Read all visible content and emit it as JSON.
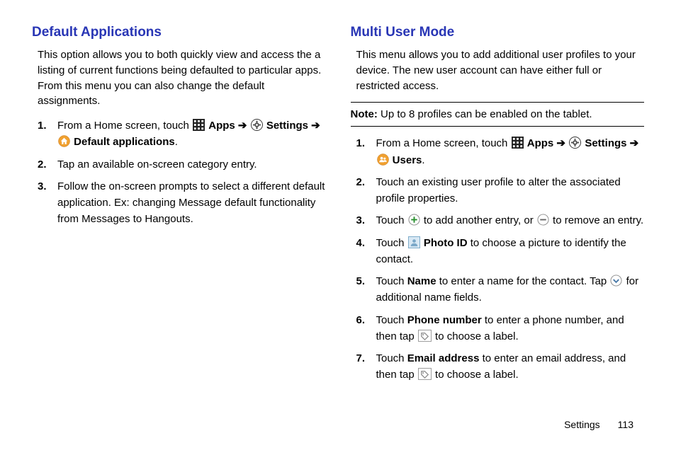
{
  "left": {
    "heading": "Default Applications",
    "intro": "This option allows you to both quickly view and access the a listing of current functions being defaulted to particular apps. From this menu you can also change the default assignments.",
    "steps": {
      "s1_a": "From a Home screen, touch ",
      "s1_apps": "Apps",
      "s1_arrow1": " ➔ ",
      "s1_settings": "Settings",
      "s1_arrow2": " ➔ ",
      "s1_default": "Default applications",
      "s1_end": ".",
      "s2": "Tap an available on-screen category entry.",
      "s3": "Follow the on-screen prompts to select a different default application. Ex: changing Message default functionality from Messages to Hangouts."
    }
  },
  "right": {
    "heading": "Multi User Mode",
    "intro": "This menu allows you to add additional user profiles to your device. The new user account can have either full or restricted access.",
    "note_label": "Note:",
    "note_text": " Up to 8 profiles can be enabled on the tablet.",
    "steps": {
      "s1_a": "From a Home screen, touch ",
      "s1_apps": "Apps",
      "s1_arrow1": " ➔ ",
      "s1_settings": "Settings",
      "s1_arrow2": " ➔ ",
      "s1_users": "Users",
      "s1_end": ".",
      "s2": "Touch an existing user profile to alter the associated profile properties.",
      "s3_a": "Touch ",
      "s3_b": " to add another entry, or ",
      "s3_c": " to remove an entry.",
      "s4_a": "Touch ",
      "s4_photo": "Photo ID",
      "s4_b": " to choose a picture to identify the contact.",
      "s5_a": "Touch ",
      "s5_name": "Name",
      "s5_b": " to enter a name for the contact. Tap ",
      "s5_c": " for additional name fields.",
      "s6_a": "Touch ",
      "s6_phone": "Phone number",
      "s6_b": " to enter a phone number, and then tap ",
      "s6_c": " to choose a label.",
      "s7_a": "Touch ",
      "s7_email": "Email address",
      "s7_b": " to enter an email address, and then tap ",
      "s7_c": " to choose a label."
    }
  },
  "footer": {
    "section": "Settings",
    "page": "113"
  }
}
